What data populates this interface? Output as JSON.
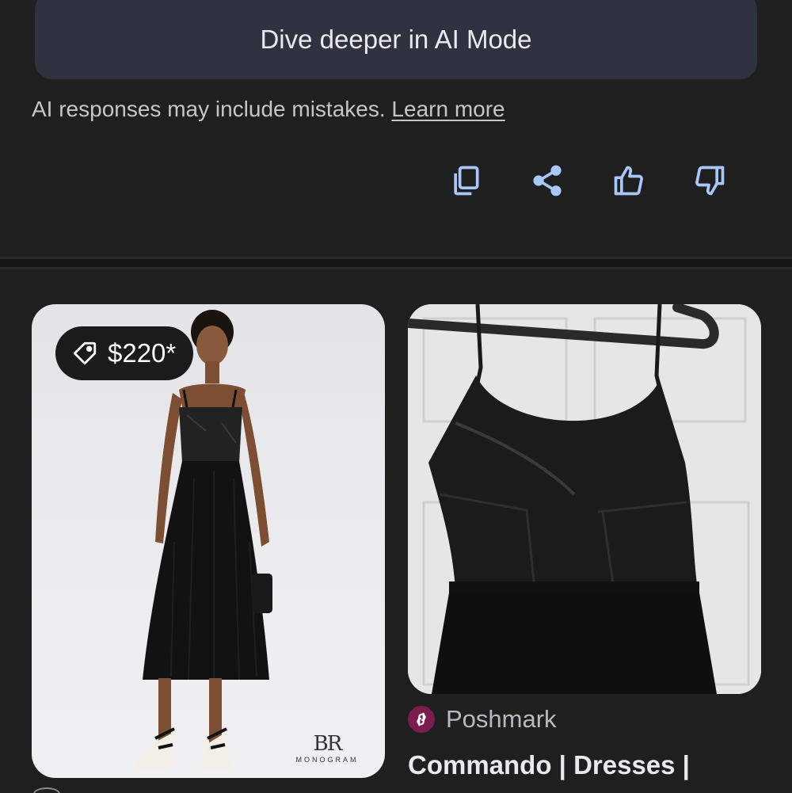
{
  "ai_mode": {
    "button_label": "Dive deeper in AI Mode"
  },
  "disclaimer": {
    "text": "AI responses may include mistakes.",
    "link_label": "Learn more"
  },
  "actions": {
    "icons": [
      "copy-icon",
      "share-icon",
      "thumbs-up-icon",
      "thumbs-down-icon"
    ],
    "icon_color": "#a8c7fa"
  },
  "products": [
    {
      "price": "$220*",
      "brand_mark": "BR",
      "brand_word": "MONOGRAM"
    },
    {
      "source": "Poshmark",
      "title": "Commando | Dresses |",
      "source_color": "#7b1d4e"
    }
  ]
}
